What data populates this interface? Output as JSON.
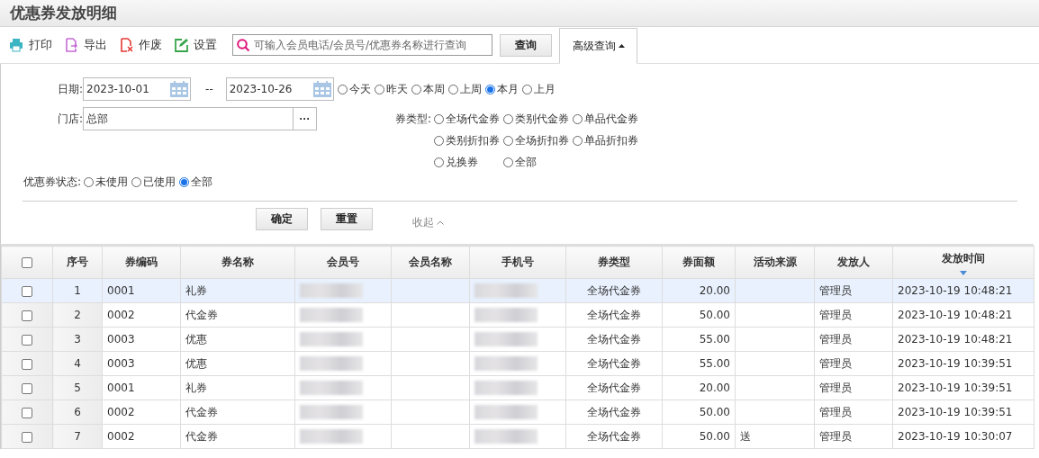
{
  "window": {
    "title": "优惠券发放明细"
  },
  "toolbar": {
    "buttons": [
      {
        "kind": "print",
        "label": "打印"
      },
      {
        "kind": "export",
        "label": "导出"
      },
      {
        "kind": "void",
        "label": "作废"
      },
      {
        "kind": "settings",
        "label": "设置"
      }
    ],
    "search": {
      "placeholder": "可输入会员电话/会员号/优惠券名称进行查询"
    },
    "search_button": "查询",
    "advanced_tab": {
      "label": "高级查询",
      "expanded": true
    }
  },
  "filters": {
    "date_label": "日期:",
    "date_from": "2023-10-01",
    "date_sep": "--",
    "date_to": "2023-10-26",
    "date_presets": [
      {
        "label": "今天",
        "selected": false
      },
      {
        "label": "昨天",
        "selected": false
      },
      {
        "label": "本周",
        "selected": false
      },
      {
        "label": "上周",
        "selected": false
      },
      {
        "label": "本月",
        "selected": true
      },
      {
        "label": "上月",
        "selected": false
      }
    ],
    "store_label": "门店:",
    "store": "总部",
    "store_button": "···",
    "type_label": "券类型:",
    "types": [
      {
        "label": "全场代金券",
        "selected": false
      },
      {
        "label": "类别代金券",
        "selected": false
      },
      {
        "label": "单品代金券",
        "selected": false
      },
      {
        "label": "类别折扣券",
        "selected": false
      },
      {
        "label": "全场折扣券",
        "selected": false
      },
      {
        "label": "单品折扣券",
        "selected": false
      },
      {
        "label": "兑换券",
        "selected": false
      },
      {
        "label": "全部",
        "selected": false
      }
    ],
    "status_label": "优惠券状态:",
    "statuses": [
      {
        "label": "未使用",
        "selected": false
      },
      {
        "label": "已使用",
        "selected": false
      },
      {
        "label": "全部",
        "selected": true
      }
    ],
    "confirm": "确定",
    "reset": "重置",
    "collapse": "收起"
  },
  "table": {
    "all_checked": false,
    "columns": [
      {
        "label": "序号",
        "sorted": false
      },
      {
        "label": "券编码",
        "sorted": false
      },
      {
        "label": "券名称",
        "sorted": false
      },
      {
        "label": "会员号",
        "sorted": false
      },
      {
        "label": "会员名称",
        "sorted": false
      },
      {
        "label": "手机号",
        "sorted": false
      },
      {
        "label": "券类型",
        "sorted": false
      },
      {
        "label": "券面额",
        "sorted": false
      },
      {
        "label": "活动来源",
        "sorted": false
      },
      {
        "label": "发放人",
        "sorted": false
      },
      {
        "label": "发放时间",
        "sorted": true
      }
    ],
    "rows": [
      {
        "selected": true,
        "checked": false,
        "redacted": true,
        "cells": [
          "1",
          "0001",
          "礼券",
          "",
          "",
          "",
          "全场代金券",
          "20.00",
          "",
          "管理员",
          "2023-10-19 10:48:21"
        ]
      },
      {
        "selected": false,
        "checked": false,
        "redacted": true,
        "cells": [
          "2",
          "0002",
          "代金券",
          "",
          "",
          "",
          "全场代金券",
          "50.00",
          "",
          "管理员",
          "2023-10-19 10:48:21"
        ]
      },
      {
        "selected": false,
        "checked": false,
        "redacted": true,
        "cells": [
          "3",
          "0003",
          "优惠",
          "",
          "",
          "",
          "全场代金券",
          "55.00",
          "",
          "管理员",
          "2023-10-19 10:48:21"
        ]
      },
      {
        "selected": false,
        "checked": false,
        "redacted": true,
        "cells": [
          "4",
          "0003",
          "优惠",
          "",
          "",
          "",
          "全场代金券",
          "55.00",
          "",
          "管理员",
          "2023-10-19 10:39:51"
        ]
      },
      {
        "selected": false,
        "checked": false,
        "redacted": true,
        "cells": [
          "5",
          "0001",
          "礼券",
          "",
          "",
          "",
          "全场代金券",
          "20.00",
          "",
          "管理员",
          "2023-10-19 10:39:51"
        ]
      },
      {
        "selected": false,
        "checked": false,
        "redacted": true,
        "cells": [
          "6",
          "0002",
          "代金券",
          "",
          "",
          "",
          "全场代金券",
          "50.00",
          "",
          "管理员",
          "2023-10-19 10:39:51"
        ]
      },
      {
        "selected": false,
        "checked": false,
        "redacted": true,
        "cells": [
          "7",
          "0002",
          "代金券",
          "",
          "",
          "",
          "全场代金券",
          "50.00",
          "送",
          "管理员",
          "2023-10-19 10:30:07"
        ]
      }
    ]
  }
}
